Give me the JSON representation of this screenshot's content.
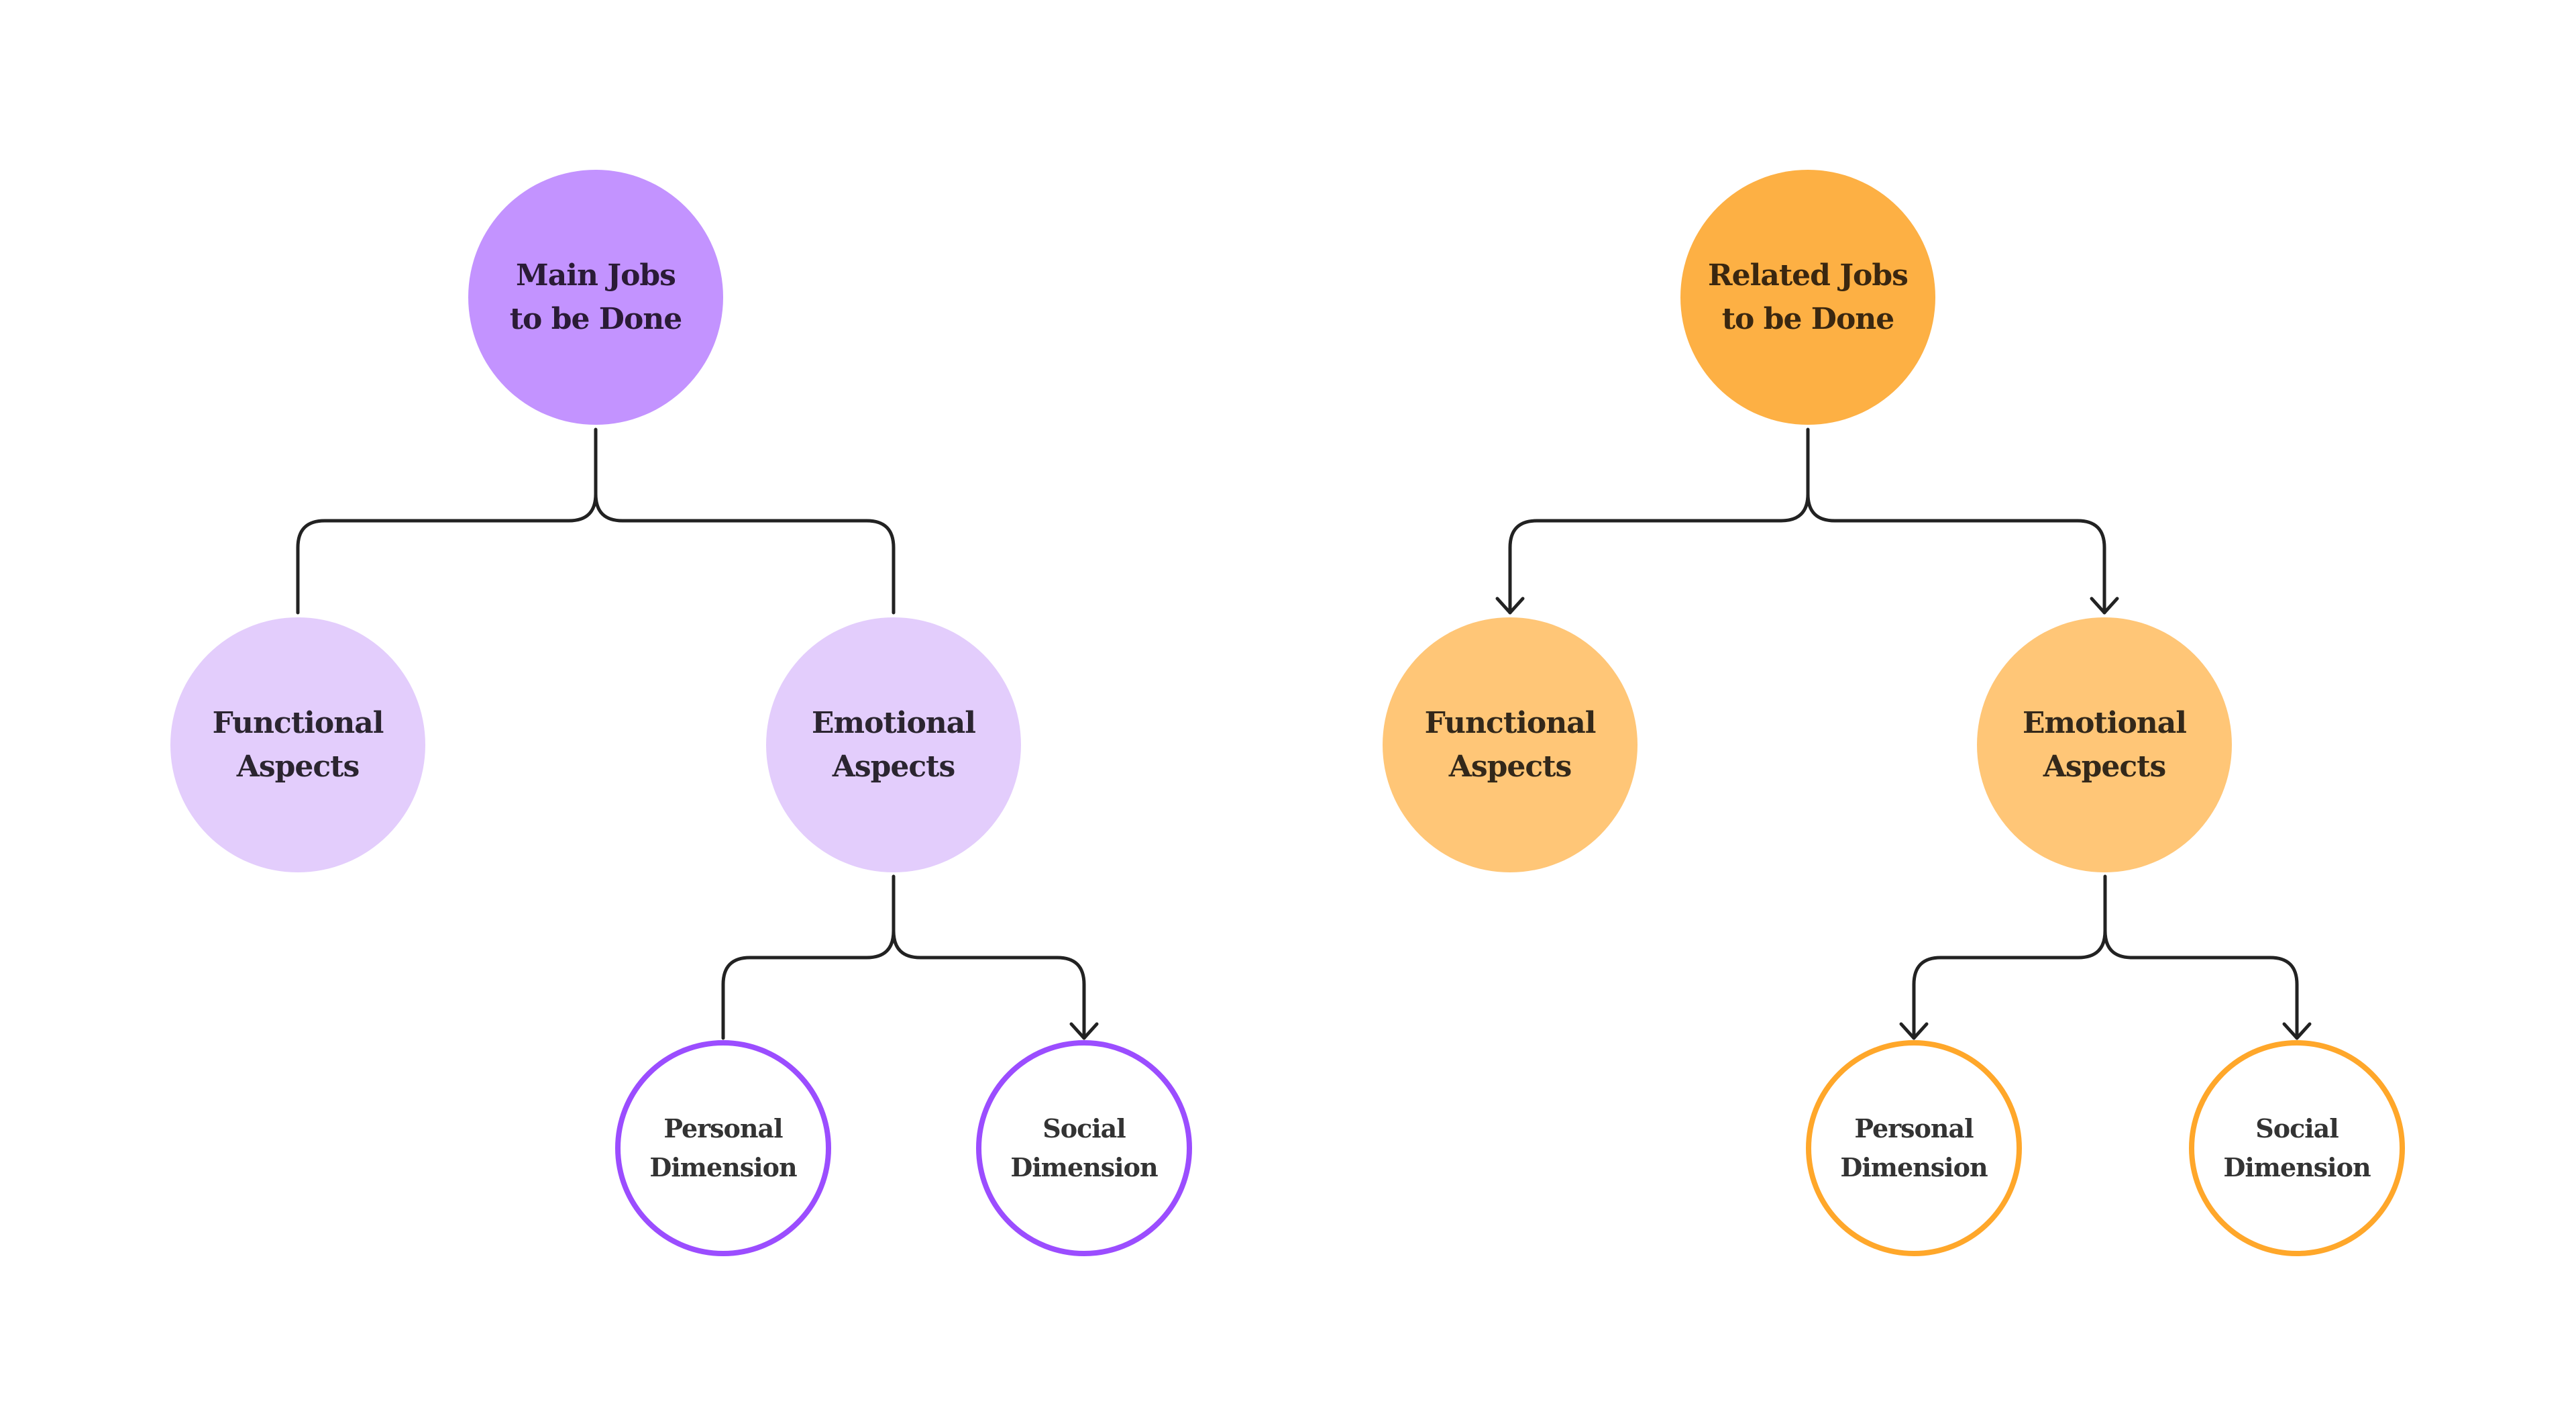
{
  "diagram": {
    "type": "tree",
    "trees": [
      {
        "id": "main",
        "theme": {
          "root_fill": "#C393FF",
          "child_fill": "#E3CDFC",
          "leaf_stroke": "#9B4DFF",
          "root_text": "#2A1B36",
          "child_text": "#2B2530",
          "leaf_text": "#333333"
        },
        "root": {
          "label_lines": [
            "Main Jobs",
            "to be Done"
          ]
        },
        "children": [
          {
            "id": "functional",
            "label_lines": [
              "Functional",
              "Aspects"
            ],
            "arrow": false
          },
          {
            "id": "emotional",
            "label_lines": [
              "Emotional",
              "Aspects"
            ],
            "arrow": false,
            "children": [
              {
                "id": "personal",
                "label_lines": [
                  "Personal",
                  "Dimension"
                ],
                "arrow": false
              },
              {
                "id": "social",
                "label_lines": [
                  "Social",
                  "Dimension"
                ],
                "arrow": true
              }
            ]
          }
        ]
      },
      {
        "id": "related",
        "theme": {
          "root_fill": "#FDB044",
          "child_fill": "#FFC677",
          "leaf_stroke": "#FFA72A",
          "root_text": "#3A2710",
          "child_text": "#33281A",
          "leaf_text": "#333333"
        },
        "root": {
          "label_lines": [
            "Related Jobs",
            "to be Done"
          ]
        },
        "children": [
          {
            "id": "functional",
            "label_lines": [
              "Functional",
              "Aspects"
            ],
            "arrow": true
          },
          {
            "id": "emotional",
            "label_lines": [
              "Emotional",
              "Aspects"
            ],
            "arrow": true,
            "children": [
              {
                "id": "personal",
                "label_lines": [
                  "Personal",
                  "Dimension"
                ],
                "arrow": true
              },
              {
                "id": "social",
                "label_lines": [
                  "Social",
                  "Dimension"
                ],
                "arrow": true
              }
            ]
          }
        ]
      }
    ],
    "connector_color": "#222222"
  }
}
